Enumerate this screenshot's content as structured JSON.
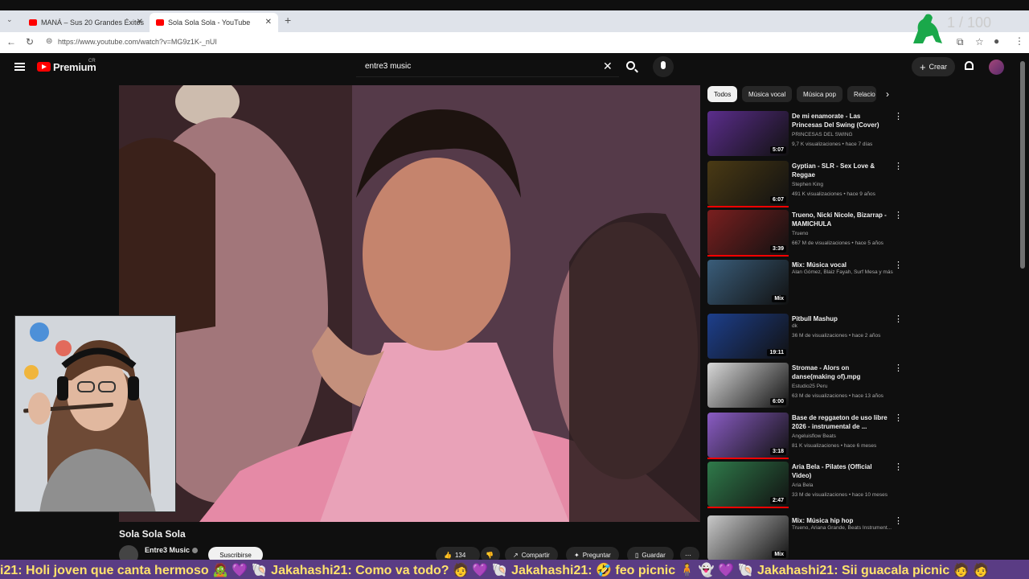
{
  "browser": {
    "tabs": [
      {
        "label": "MANÁ – Sus 20 Grandes Éxitos",
        "active": false
      },
      {
        "label": "Sola Sola Sola - YouTube",
        "active": true
      }
    ],
    "url": "https://www.youtube.com/watch?v=MG9z1K-_nUI"
  },
  "header": {
    "logo": "Premium",
    "logo_region": "CR",
    "search_value": "entre3 music",
    "create_label": "Crear"
  },
  "video": {
    "title": "Sola Sola Sola",
    "channel": "Entre3 Music",
    "subscribe_label": "Suscribirse",
    "likes": "134",
    "share_label": "Compartir",
    "ask_label": "Preguntar",
    "save_label": "Guardar"
  },
  "chips": [
    "Todos",
    "Música vocal",
    "Música pop",
    "Relacio"
  ],
  "recommendations": [
    {
      "title": "De mi enamorate - Las Princesas Del Swing (Cover)",
      "channel": "PRINCESAS DEL SWING",
      "meta": "9,7 K visualizaciones • hace 7 días",
      "duration": "5:07",
      "thumb_color": "#5b2d8c"
    },
    {
      "title": "Gyptian - SLR - Sex Love & Reggae",
      "channel": "Stephen King",
      "meta": "491 K visualizaciones • hace 9 años",
      "duration": "6:07",
      "thumb_color": "#4a3a14"
    },
    {
      "title": "Trueno, Nicki Nicole, Bizarrap - MAMICHULA",
      "channel": "Trueno",
      "meta": "667 M de visualizaciones • hace 5 años",
      "duration": "3:39",
      "thumb_color": "#7a1f1f"
    },
    {
      "title": "Mix: Música vocal",
      "channel": "Alan Gómez, Blaiz Fayah, Surf Mesa y más",
      "meta": "",
      "duration": "Mix",
      "thumb_color": "#3a5d7a"
    },
    {
      "title": "Pitbull Mashup",
      "channel": "dk",
      "meta": "36 M de visualizaciones • hace 2 años",
      "duration": "19:11",
      "thumb_color": "#1d3f8c"
    },
    {
      "title": "Stromae - Alors on danse(making of).mpg",
      "channel": "Estudio25 Peru",
      "meta": "63 M de visualizaciones • hace 13 años",
      "duration": "6:00",
      "thumb_color": "#d8d8d8"
    },
    {
      "title": "Base de reggaeton de uso libre 2026 - instrumental de ...",
      "channel": "Angeluisflow Beats",
      "meta": "81 K visualizaciones • hace 6 meses",
      "duration": "3:18",
      "thumb_color": "#8a5cc4"
    },
    {
      "title": "Aria Bela - Pilates (Official Video)",
      "channel": "Aria Bela",
      "meta": "33 M de visualizaciones • hace 10 meses",
      "duration": "2:47",
      "thumb_color": "#2f7a4a"
    },
    {
      "title": "Mix: Música hip hop",
      "channel": "Trueno, Ariana Grande, Beats Instrument...",
      "meta": "",
      "duration": "Mix",
      "thumb_color": "#c9c9c9"
    }
  ],
  "chat_ticker": "i21: Holi joven que canta hermoso 🧟 💜 🐚 Jakahashi21: Como va todo? 🧑 💜 🐚 Jakahashi21: 🤣 feo picnic 🧍 👻 💜 🐚 Jakahashi21: Sii guacala picnic 🧑 🧑",
  "overlay": {
    "counter": "1 / 100"
  }
}
